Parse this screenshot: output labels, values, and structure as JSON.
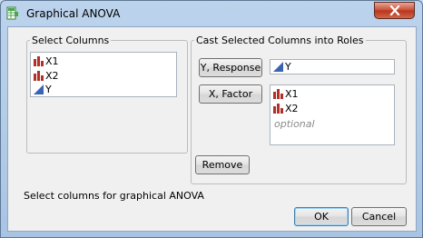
{
  "window": {
    "title": "Graphical ANOVA",
    "close_icon": "close-icon",
    "app_icon": "table-icon"
  },
  "select_columns": {
    "legend": "Select Columns",
    "items": [
      {
        "label": "X1",
        "icon": "nominal-bar-icon"
      },
      {
        "label": "X2",
        "icon": "nominal-bar-icon"
      },
      {
        "label": "Y",
        "icon": "continuous-triangle-icon"
      }
    ]
  },
  "roles": {
    "legend": "Cast Selected Columns into Roles",
    "response_button": "Y, Response",
    "response_items": [
      {
        "label": "Y",
        "icon": "continuous-triangle-icon"
      }
    ],
    "factor_button": "X, Factor",
    "factor_items": [
      {
        "label": "X1",
        "icon": "nominal-bar-icon"
      },
      {
        "label": "X2",
        "icon": "nominal-bar-icon"
      }
    ],
    "factor_placeholder": "optional",
    "remove_button": "Remove"
  },
  "status_text": "Select columns for graphical ANOVA",
  "buttons": {
    "ok": "OK",
    "cancel": "Cancel"
  },
  "colors": {
    "nominal": "#b0302a",
    "continuous": "#3a63b3",
    "accent": "#3c7fb1"
  }
}
